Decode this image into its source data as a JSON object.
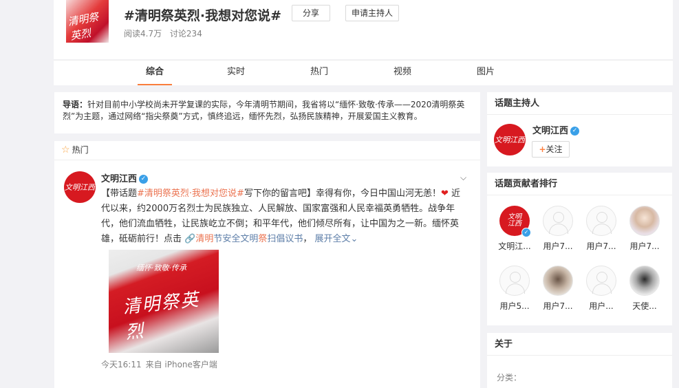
{
  "topic": {
    "title": "#清明祭英烈·我想对您说#",
    "share_label": "分享",
    "host_apply_label": "申请主持人",
    "reads": "阅读4.7万",
    "discussions": "讨论234",
    "cover_text": "清明祭英烈"
  },
  "tabs": [
    {
      "label": "综合",
      "active": true
    },
    {
      "label": "实时"
    },
    {
      "label": "热门"
    },
    {
      "label": "视频"
    },
    {
      "label": "图片"
    }
  ],
  "intro": {
    "lead": "导语：",
    "text": "针对目前中小学校尚未开学复课的实际，今年清明节期间，我省将以“缅怀·致敬·传承——2020清明祭英烈”为主题，通过网络“指尖祭奠”方式，慎终追远，缅怀先烈，弘扬民族精神，开展爱国主义教育。"
  },
  "feed": {
    "section_label": "热门",
    "post": {
      "avatar_text": "文明江西",
      "user": "文明江西",
      "text_prefix": "【带话题",
      "hashtag": "#清明祭英烈·我想对您说#",
      "text_mid": "写下你的留言吧】幸得有你，今日中国山河无恙！",
      "text_main": " 近代以来，约2000万名烈士为民族独立、人民解放、国家富强和人民幸福英勇牺牲。战争年代，他们流血牺牲，让民族屹立不倒；和平年代，他们倾尽所有，让中国为之一新。缅怀英雄，砥砺前行！点击 ",
      "link_a": "清明",
      "link_b": "节安全文明",
      "link_c": "祭",
      "link_d": "扫倡议书",
      "expand": "展开全文",
      "image_top_text": "缅怀·致敬·传承",
      "image_main_text": "清明祭英烈",
      "time": "今天16:11",
      "source": "来自 iPhone客户端"
    }
  },
  "sidebar": {
    "host_title": "话题主持人",
    "host_name": "文明江西",
    "host_avatar_text": "文明江西",
    "follow_label": "关注",
    "rank_title": "话题贡献者排行",
    "contributors": [
      {
        "name": "文明江..."
      },
      {
        "name": "用户7..."
      },
      {
        "name": "用户7..."
      },
      {
        "name": "用户7..."
      },
      {
        "name": "用户5..."
      },
      {
        "name": "用户7..."
      },
      {
        "name": "用户..."
      },
      {
        "name": "天使..."
      }
    ],
    "about_title": "关于",
    "category_label": "分类："
  },
  "colors": {
    "accent": "#fa7d3c",
    "topic_red": "#d71920",
    "hashtag": "#eb7350",
    "link": "#5d7ea8"
  }
}
